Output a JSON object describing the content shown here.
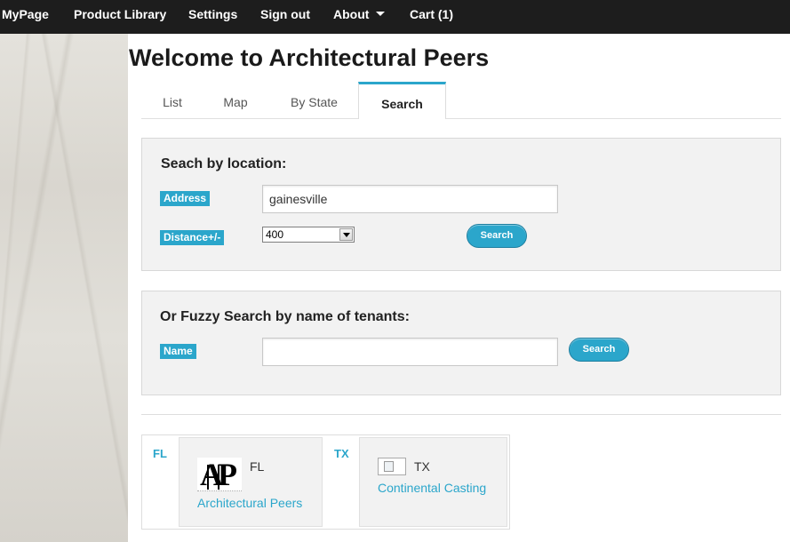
{
  "navbar": {
    "items": [
      {
        "label": "MyPage"
      },
      {
        "label": "Product Library"
      },
      {
        "label": "Settings"
      },
      {
        "label": "Sign out"
      },
      {
        "label": "About"
      },
      {
        "label": "Cart (1)"
      }
    ]
  },
  "page": {
    "title": "Welcome to Architectural Peers"
  },
  "tabs": [
    {
      "label": "List"
    },
    {
      "label": "Map"
    },
    {
      "label": "By State"
    },
    {
      "label": "Search",
      "active": true
    }
  ],
  "location_search": {
    "heading": "Seach by location:",
    "address_label": "Address",
    "address_value": "gainesville",
    "distance_label": "Distance+/-",
    "distance_value": "400",
    "button_label": "Search"
  },
  "fuzzy_search": {
    "heading": "Or Fuzzy Search by name of tenants:",
    "name_label": "Name",
    "name_value": "",
    "button_label": "Search"
  },
  "results": [
    {
      "state": "FL",
      "card_state": "FL",
      "name": "Architectural Peers",
      "logo_text": "AP",
      "logo": "architectural-peers-logo"
    },
    {
      "state": "TX",
      "card_state": "TX",
      "name": "Continental Casting",
      "logo": "broken-image-icon"
    }
  ],
  "colors": {
    "accent": "#2ba6cb",
    "navbar": "#1d1d1d",
    "panel": "#f2f2f2"
  }
}
